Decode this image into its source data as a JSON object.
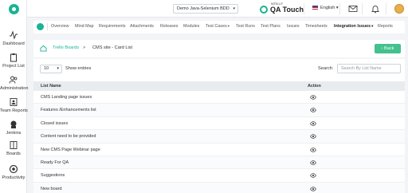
{
  "sidebar": {
    "items": [
      {
        "label": "Dashboard",
        "icon": "activity-icon"
      },
      {
        "label": "Project List",
        "icon": "clipboard-icon"
      },
      {
        "label": "Administration",
        "icon": "users-icon"
      },
      {
        "label": "Team Reports",
        "icon": "team-report-icon"
      },
      {
        "label": "Jenkins",
        "icon": "jenkins-icon"
      },
      {
        "label": "Boards",
        "icon": "board-icon"
      },
      {
        "label": "Productivity",
        "icon": "productivity-icon"
      }
    ]
  },
  "topbar": {
    "project": "Demo Java-Selenium BDD",
    "brand_small": "INTELLIT",
    "brand_name": "QA Touch",
    "language": "English"
  },
  "tabs": [
    {
      "label": "Overview",
      "has_caret": false
    },
    {
      "label": "Mind Map",
      "has_caret": false
    },
    {
      "label": "Requirements",
      "has_caret": false
    },
    {
      "label": "Attachments",
      "has_caret": false
    },
    {
      "label": "Releases",
      "has_caret": false
    },
    {
      "label": "Modules",
      "has_caret": false
    },
    {
      "label": "Test Cases",
      "has_caret": true
    },
    {
      "label": "Test Runs",
      "has_caret": false
    },
    {
      "label": "Test Plans",
      "has_caret": false
    },
    {
      "label": "Issues",
      "has_caret": false
    },
    {
      "label": "Timesheets",
      "has_caret": false
    },
    {
      "label": "Integration Issues",
      "has_caret": true,
      "active": true
    },
    {
      "label": "Reports",
      "has_caret": false
    }
  ],
  "breadcrumb": {
    "link": "Trello Boards",
    "separator": ">",
    "current": "CMS site - Card List"
  },
  "back_button": "Back",
  "table_controls": {
    "length_value": "10",
    "length_label": "Show entries",
    "search_label": "Search:",
    "search_placeholder": "Search By List Name"
  },
  "table": {
    "columns": [
      "List Name",
      "Action"
    ],
    "rows": [
      "CMS Landing page issues",
      "Features /Enhancements list",
      "Closed issues",
      "Content need to be provided",
      "New CMS Page Webinar page",
      "Ready For QA",
      "Suggestions",
      "New board"
    ]
  },
  "colors": {
    "accent": "#1ab394",
    "back_button": "#43c18f"
  }
}
